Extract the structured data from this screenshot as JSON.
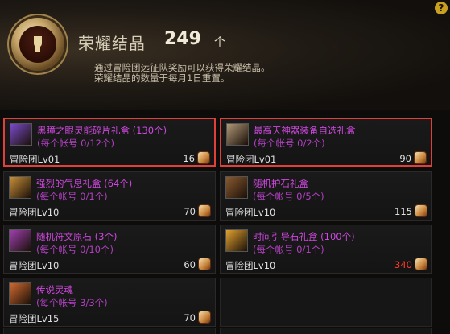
{
  "header": {
    "title": "荣耀结晶",
    "count": "249",
    "unit": "个",
    "desc_line1": "通过冒险团远征队奖励可以获得荣耀结晶。",
    "desc_line2": "荣耀结晶的数量于每月1日重置。",
    "help": "?"
  },
  "shop": {
    "items": [
      {
        "name": "黑瞳之眼灵能碎片礼盒 (130个)",
        "limit": "(每个帐号 0/12个)",
        "level": "冒险团Lv01",
        "price": "16",
        "selected": true,
        "icon_color": "#7a4ac8"
      },
      {
        "name": "最高天神器装备自选礼盒",
        "limit": "(每个帐号 0/2个)",
        "level": "冒险团Lv01",
        "price": "90",
        "selected": true,
        "icon_color": "#b09878"
      },
      {
        "name": "强烈的气息礼盒 (64个)",
        "limit": "(每个帐号 0/1个)",
        "level": "冒险团Lv10",
        "price": "70",
        "icon_color": "#c8903a"
      },
      {
        "name": "随机护石礼盒",
        "limit": "(每个帐号 0/5个)",
        "level": "冒险团Lv10",
        "price": "115",
        "icon_color": "#8a5a30"
      },
      {
        "name": "随机符文原石 (3个)",
        "limit": "(每个帐号 0/10个)",
        "level": "冒险团Lv10",
        "price": "60",
        "icon_color": "#a040b0"
      },
      {
        "name": "时间引导石礼盒 (100个)",
        "limit": "(每个帐号 0/1个)",
        "level": "冒险团Lv10",
        "price": "340",
        "price_red": true,
        "icon_color": "#e0a030"
      },
      {
        "name": "传说灵魂",
        "limit": "(每个帐号 3/3个)",
        "level": "冒险团Lv15",
        "price": "70",
        "icon_color": "#d06a30"
      }
    ]
  },
  "colors": {
    "item_name": "#d048e0",
    "selection_border": "#e0403a",
    "price_warning": "#ff3a2a"
  }
}
